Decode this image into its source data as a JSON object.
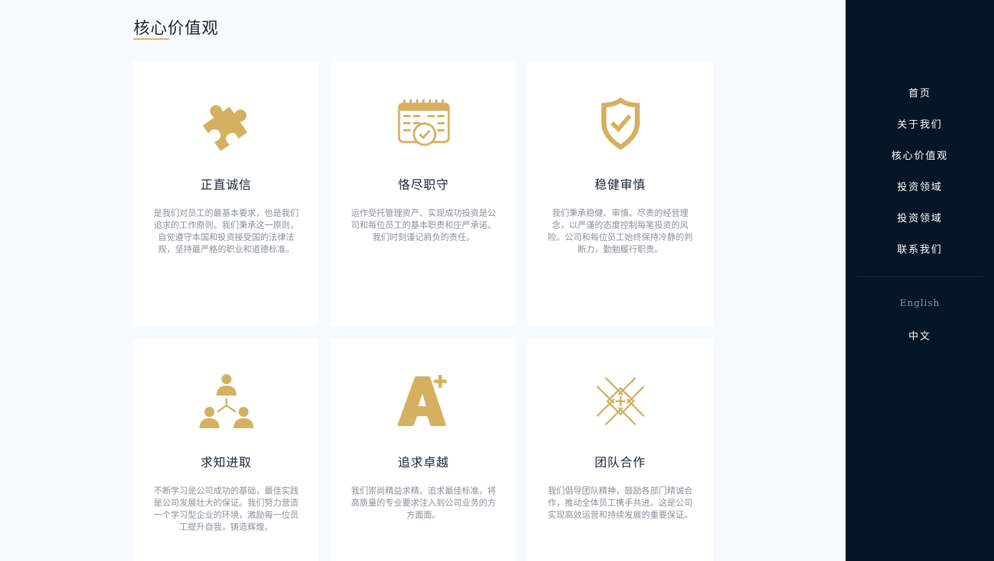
{
  "section": {
    "title": "核心价值观"
  },
  "cards": [
    {
      "icon": "puzzle-icon",
      "title": "正直诚信",
      "desc": "是我们对员工的最基本要求，也是我们追求的工作原则。我们秉承这一原则，自觉遵守本国和投资接受国的法律法规，坚持最严格的职业和道德标准。"
    },
    {
      "icon": "calendar-check-icon",
      "title": "恪尽职守",
      "desc": "运作受托管理资产、实现成功投资是公司和每位员工的基本职责和庄严承诺。我们时刻谨记肩负的责任。"
    },
    {
      "icon": "shield-check-icon",
      "title": "稳健审慎",
      "desc": "我们秉承稳健、审慎、尽责的经营理念，以严谨的态度控制每笔投资的风险。公司和每位员工始终保持冷静的判断力，勤勉履行职责。"
    },
    {
      "icon": "team-hierarchy-icon",
      "title": "求知进取",
      "desc": "不断学习是公司成功的基础，最佳实践是公司发展壮大的保证。我们努力营造一个学习型企业的环境，激励每一位员工提升自我，铸造辉煌。"
    },
    {
      "icon": "a-plus-icon",
      "title": "追求卓越",
      "desc": "我们崇尚精益求精、追求最佳标准，将高质量的专业要求注入到公司业务的方方面面。"
    },
    {
      "icon": "hands-together-icon",
      "title": "团队合作",
      "desc": "我们倡导团队精神，鼓励各部门精诚合作，推动全体员工携手共进。这是公司实现高效运营和持续发展的重要保证。"
    }
  ],
  "nav": {
    "items": [
      "首页",
      "关于我们",
      "核心价值观",
      "投资领域",
      "投资领域",
      "联系我们"
    ],
    "languages": [
      "English",
      "中文"
    ]
  },
  "colors": {
    "accent": "#d4b060",
    "sidebar": "#051626",
    "background": "#f7fafd"
  }
}
